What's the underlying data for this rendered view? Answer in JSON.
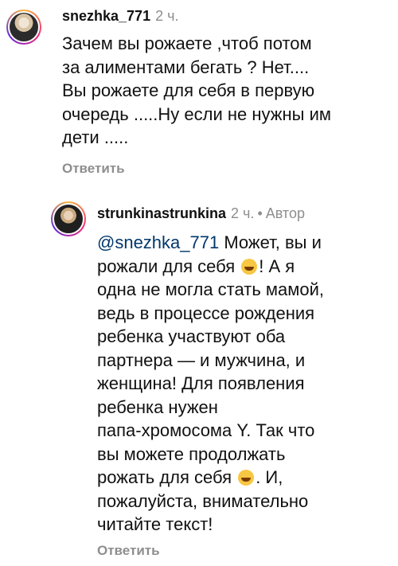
{
  "comments": [
    {
      "username": "snezhka_771",
      "time": "2 ч.",
      "lines": [
        "Зачем вы рожаете ,чтоб потом",
        "за алиментами бегать ? Нет....",
        "Вы рожаете для себя в первую",
        "очередь .....Ну если не нужны им",
        "дети ....."
      ],
      "reply_label": "Ответить"
    },
    {
      "username": "strunkinastrunkina",
      "time": "2 ч.",
      "author_label": "Автор",
      "mention": "@snezhka_771",
      "line1_rest": " Может, вы и",
      "line2": "рожали для себя ",
      "line2_end": "! А я",
      "middle_lines": [
        "одна не могла стать мамой,",
        "ведь в процессе рождения",
        "ребенка участвуют оба",
        "партнера — и мужчина, и",
        "женщина! Для появления",
        "ребенка нужен",
        "папа-хромосома Y. Так что",
        "вы можете продолжать"
      ],
      "line_emoji2_start": "рожать для себя ",
      "line_emoji2_end": ". И,",
      "last_lines": [
        "пожалуйста, внимательно",
        "читайте текст!"
      ],
      "emoji_name": "laughing-tears-emoji",
      "reply_label": "Ответить"
    }
  ]
}
